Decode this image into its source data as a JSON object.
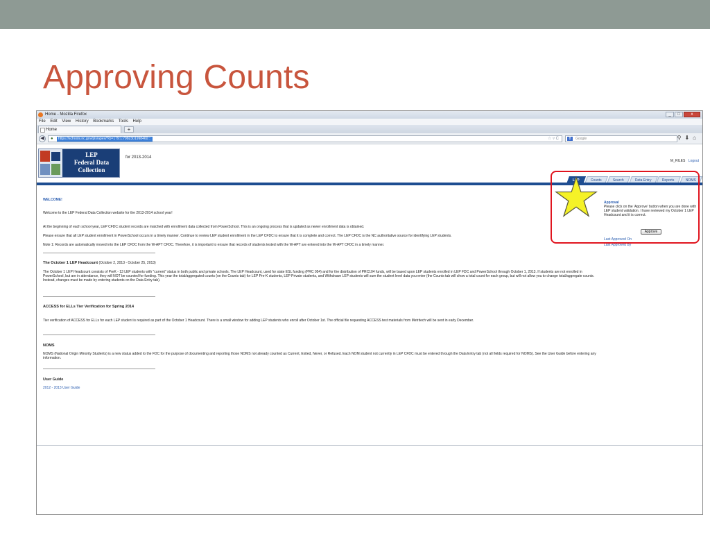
{
  "slide": {
    "title": "Approving Counts"
  },
  "browser": {
    "window_title": "Home - Mozilla Firefox",
    "menus": [
      "File",
      "Edit",
      "View",
      "History",
      "Bookmarks",
      "Tools",
      "Help"
    ],
    "tab_label": "Home",
    "new_tab": "+",
    "url": "https://schools.nc.gov/pls/apex/f?p=179:1:7982301998460:::",
    "search_placeholder": "Google"
  },
  "app": {
    "logo_text": [
      "LEP",
      "Federal Data",
      "Collection"
    ],
    "year_label": "for 2013-2014",
    "user": "M_RILES",
    "logout": "Logout",
    "tabs": [
      "LEP",
      "Counts",
      "Search",
      "Data Entry",
      "Reports",
      "NOMS"
    ],
    "active_tab": "LEP"
  },
  "content": {
    "welcome": "WELCOME!",
    "p1": "Welcome to the LEP Federal Data Collection website for the 2013-2014 school year!",
    "p2": "At the beginning of each school year, LEP CFDC student records are matched with enrollment data collected from PowerSchool. This is an ongoing process that is updated as newer enrollment data is obtained.",
    "p3": "Please ensure that all LEP student enrollment in PowerSchool occurs in a timely manner. Continue to review LEP student enrollment in the LEP CFDC to ensure that it is complete and correct. The LEP CFDC is the NC authoritative source for identifying LEP students.",
    "p4": "Note 1: Records are automatically moved into the LEP CFDC from the W-APT CFDC. Therefore, it is important to ensure that records of students tested with the W-APT are entered into the W-APT CFDC in a timely manner.",
    "h1": "The October 1 LEP Headcount",
    "h1_dates": "(October 2, 2013 - October 25, 2013)",
    "p5": "The October 1 LEP Headcount consists of PreK - 13 LEP students with \"current\" status in both public and private schools. The LEP Headcount, used for state ESL funding (PRC 054) and for the distribution of PRC104 funds, will be based upon LEP students enrolled in LEP FDC and PowerSchool through October 1, 2013. If students are not enrolled in PowerSchool, but are in attendance, they will NOT be counted for funding. This year the total/aggregated counts (on the Counts tab) for LEP Pre-K students, LEP Private students, and Withdrawn LEP students will sum the student level data you enter (the Counts tab will show a total count for each group, but will not allow you to change total/aggregate counts. Instead, changes must be made by entering students on the Data Entry tab).",
    "h2": "ACCESS for ELLs Tier Verification for Spring 2014",
    "p6": "Tier verification of ACCESS for ELLs for each LEP student is required as part of the October 1 Headcount. There is a small window for adding LEP students who enroll after October 1st. The official file requesting ACCESS test materials from Metritech will be sent in early December.",
    "h3": "NOMS",
    "p7": "NOMS (National Origin Minority Students) is a new status added to the FDC for the purpose of documenting and reporting those NOMS not already counted as Current, Exited, Never, or Refused. Each NOM student not currently in LEP CFDC must be entered through the Data Entry tab (not all fields required for NOMS). See the User Guide before entering any information.",
    "h4": "User Guide",
    "guide_link": "2012 - 2013 User Guide"
  },
  "approval": {
    "title": "Approval",
    "text": "Please click on the 'Approve' button when you are done with LEP student validation. I have reviewed my October 1 LEP Headcount and it is correct.",
    "button": "Approve",
    "last_on": "Last Approved On",
    "last_by": "Last Approved By"
  },
  "colors": {
    "title": "#c8553d",
    "band": "#8e9a94",
    "highlight_box": "#e0141e",
    "star": "#f5f227",
    "app_blue": "#1e4d91"
  }
}
